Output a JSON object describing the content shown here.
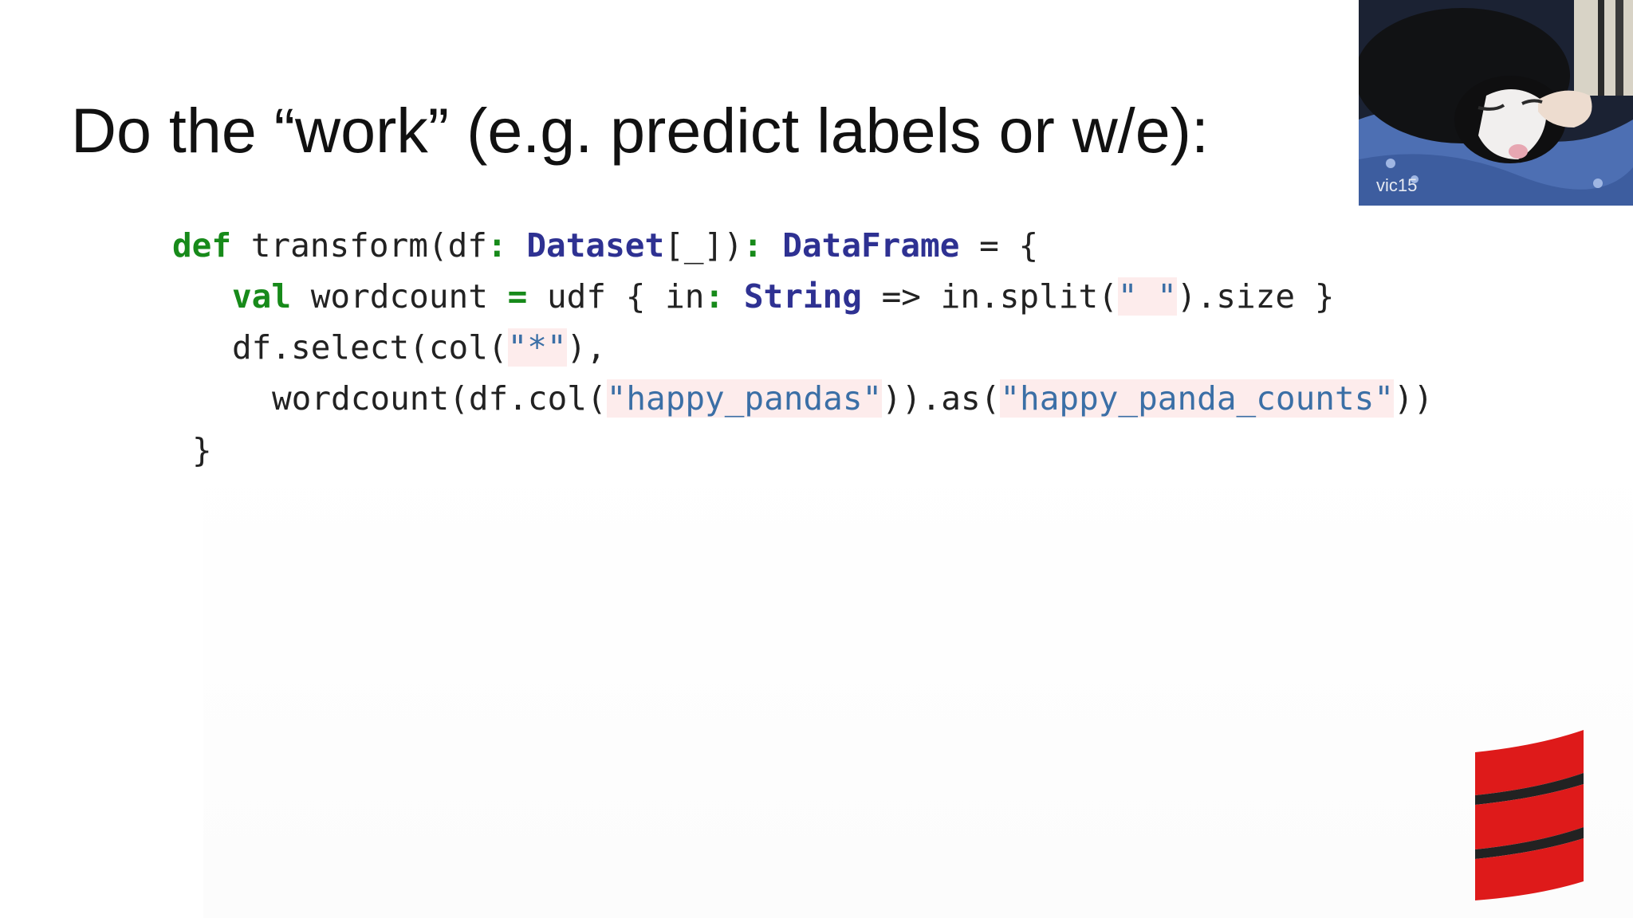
{
  "slide": {
    "title": "Do the “work” (e.g. predict labels or w/e):",
    "code": {
      "line1": {
        "kw_def": "def",
        "t1": " transform(df",
        "op1": ":",
        "sp1": " ",
        "ty_dataset": "Dataset",
        "t2": "[_])",
        "op2": ":",
        "sp2": " ",
        "ty_dataframe": "DataFrame",
        "t3": " = {"
      },
      "line2": {
        "kw_val": "val",
        "t1": " wordcount ",
        "op_eq": "=",
        "t2": " udf { in",
        "op_colon": ":",
        "sp1": " ",
        "ty_string": "String",
        "t3": " => in.split(",
        "str_space": "\" \"",
        "t4": ").size }"
      },
      "line3": {
        "t1": "df.select(col(",
        "str_star": "\"*\"",
        "t2": "),"
      },
      "line4": {
        "t1": "wordcount(df.col(",
        "str_pandas": "\"happy_pandas\"",
        "t2": ")).as(",
        "str_counts": "\"happy_panda_counts\"",
        "t3": "))"
      },
      "line5": {
        "t1": "}"
      }
    }
  },
  "webcam": {
    "label": "vic15"
  },
  "colors": {
    "keyword": "#178a1a",
    "type": "#2e3192",
    "string": "#3b6fa6",
    "string_bg": "#fdecec",
    "logo_red": "#de1a1a"
  },
  "icons": {
    "logo": "scala-logo-icon"
  }
}
